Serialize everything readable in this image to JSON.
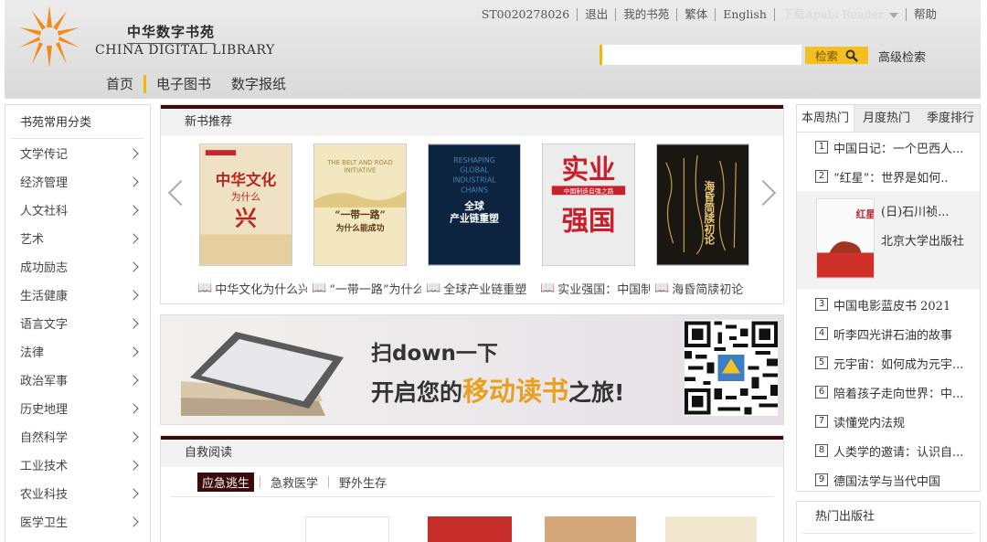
{
  "header": {
    "logo_cn": "中华数字书苑",
    "logo_en": "CHINA DIGITAL LIBRARY",
    "user_id": "ST0020278026",
    "logout": "退出",
    "my_library": "我的书苑",
    "traditional": "繁体",
    "english": "English",
    "download_reader": "下载Apabi Reader",
    "help": "帮助",
    "search": {
      "placeholder": "",
      "button_label": "检索",
      "advanced_label": "高级检索"
    },
    "nav": [
      "首页",
      "电子图书",
      "数字报纸"
    ]
  },
  "sidebar": {
    "title": "书苑常用分类",
    "categories": [
      "文学传记",
      "经济管理",
      "人文社科",
      "艺术",
      "成功励志",
      "生活健康",
      "语言文字",
      "法律",
      "政治军事",
      "历史地理",
      "自然科学",
      "工业技术",
      "农业科技",
      "医学卫生"
    ]
  },
  "new_books": {
    "title": "新书推荐",
    "books": [
      {
        "caption": "中华文化为什么兴",
        "cover_title": "中华文化为什么兴",
        "cover_bg": "#efe2c4"
      },
      {
        "caption": "“一带一路”为什么能成功",
        "cover_title": "“一带一路”为什么能成功",
        "cover_subtitle": "THE BELT AND ROAD INITIATIVE",
        "cover_bg": "#f2e7c0"
      },
      {
        "caption": "全球产业链重塑",
        "cover_title": "全球产业链重塑",
        "cover_subtitle": "RESHAPING GLOBAL INDUSTRIAL CHAINS",
        "cover_bg": "#0d2440"
      },
      {
        "caption": "实业强国：中国制造自强之路",
        "cover_title": "实业强国",
        "cover_subtitle": "中国制造自强之路",
        "cover_bg": "#ececec"
      },
      {
        "caption": "海昏简牍初论",
        "cover_title": "海昏简牍初论",
        "cover_bg": "#1a1612"
      }
    ]
  },
  "banner": {
    "line1": "扫down一下",
    "line2_pre": "开启您的",
    "line2_highlight": "移动读书",
    "line2_post": "之旅!"
  },
  "self_rescue": {
    "title": "自救阅读",
    "tabs": [
      "应急逃生",
      "急救医学",
      "野外生存"
    ],
    "active_tab": "应急逃生"
  },
  "hot": {
    "tabs": [
      "本周热门",
      "月度热门",
      "季度排行"
    ],
    "active_tab": "本周热门",
    "items_before": [
      {
        "num": "1",
        "title": "中国日记：一个巴西人..."
      },
      {
        "num": "2",
        "title": "“红星”：世界是如何.."
      }
    ],
    "feature": {
      "title": "(日)石川祯...",
      "publisher": "北京大学出版社",
      "cover_text": "红星"
    },
    "items_after": [
      {
        "num": "3",
        "title": "中国电影蓝皮书 2021"
      },
      {
        "num": "4",
        "title": "听李四光讲石油的故事"
      },
      {
        "num": "5",
        "title": "元宇宙：如何成为元宇..."
      },
      {
        "num": "6",
        "title": "陪着孩子走向世界：中..."
      },
      {
        "num": "7",
        "title": "读懂党内法规"
      },
      {
        "num": "8",
        "title": "人类学的邀请：认识自..."
      },
      {
        "num": "9",
        "title": "德国法学与当代中国"
      }
    ]
  },
  "hot_publishers": {
    "title": "热门出版社"
  },
  "colors": {
    "accent": "#f2b705",
    "dark_maroon": "#3b0a0a",
    "logo_orange": "#f08c1e"
  }
}
